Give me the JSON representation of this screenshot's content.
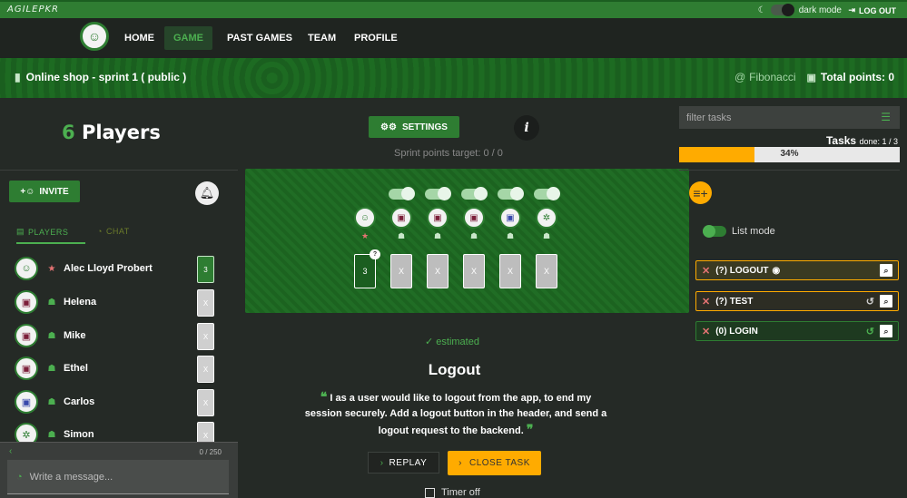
{
  "topbar": {
    "logo_main": "AGILE",
    "logo_sub": "PKR",
    "dark_mode_label": "dark mode",
    "logout_label": "LOG OUT"
  },
  "nav": {
    "items": [
      {
        "label": "HOME",
        "active": false
      },
      {
        "label": "GAME",
        "active": true
      },
      {
        "label": "PAST GAMES",
        "active": false
      },
      {
        "label": "TEAM",
        "active": false
      },
      {
        "label": "PROFILE",
        "active": false
      }
    ]
  },
  "banner": {
    "title": "Online shop - sprint 1 ( public )",
    "scale": "Fibonacci",
    "total_points": "Total points: 0"
  },
  "left": {
    "player_count": "6",
    "players_word": "Players",
    "invite_label": "INVITE",
    "tabs": {
      "players": "PLAYERS",
      "chat": "CHAT"
    },
    "players": [
      {
        "name": "Alec Lloyd Probert",
        "icon": "star-icon",
        "card": "3",
        "voted": true
      },
      {
        "name": "Helena",
        "icon": "ghost-icon",
        "card": "X",
        "voted": false
      },
      {
        "name": "Mike",
        "icon": "ghost-icon",
        "card": "X",
        "voted": false
      },
      {
        "name": "Ethel",
        "icon": "ghost-icon",
        "card": "X",
        "voted": false
      },
      {
        "name": "Carlos",
        "icon": "ghost-icon",
        "card": "X",
        "voted": false
      },
      {
        "name": "Simon",
        "icon": "ghost-icon",
        "card": "X",
        "voted": false
      }
    ],
    "chat": {
      "count": "0 / 250",
      "placeholder": "Write a message..."
    }
  },
  "center": {
    "settings_label": "SETTINGS",
    "info_label": "i",
    "sprint_target": "Sprint points target:  0 / 0",
    "seats": [
      {
        "card": "3",
        "voted": true,
        "bubble": "?",
        "mark": "star"
      },
      {
        "card": "X",
        "voted": false,
        "mark": "ghost"
      },
      {
        "card": "X",
        "voted": false,
        "mark": "ghost"
      },
      {
        "card": "X",
        "voted": false,
        "mark": "ghost"
      },
      {
        "card": "X",
        "voted": false,
        "mark": "ghost"
      },
      {
        "card": "X",
        "voted": false,
        "mark": "ghost"
      }
    ],
    "status": "estimated",
    "task_title": "Logout",
    "task_description": "I as a user would like to logout from the app, to end my session securely. Add a logout button in the header, and send a logout request to the backend.",
    "replay_label": "REPLAY",
    "close_task_label": "CLOSE TASK",
    "timer_label": "Timer off"
  },
  "right": {
    "filter_placeholder": "filter tasks",
    "tasks_title": "Tasks",
    "tasks_done": "done: 1 / 3",
    "progress_percent": 34,
    "progress_text": "34%",
    "list_mode_label": "List mode",
    "tasks": [
      {
        "label": "(?) LOGOUT",
        "border": "#ffab00",
        "bg": "#3a3a22"
      },
      {
        "label": "(?) TEST",
        "border": "#ffab00",
        "bg": "#2d2d24"
      },
      {
        "label": "(0) LOGIN",
        "border": "#2e7d32",
        "bg": "#1e3a20"
      }
    ]
  },
  "colors": {
    "accent": "#2e7d32",
    "accent_light": "#4caf50",
    "warning": "#ffab00"
  }
}
